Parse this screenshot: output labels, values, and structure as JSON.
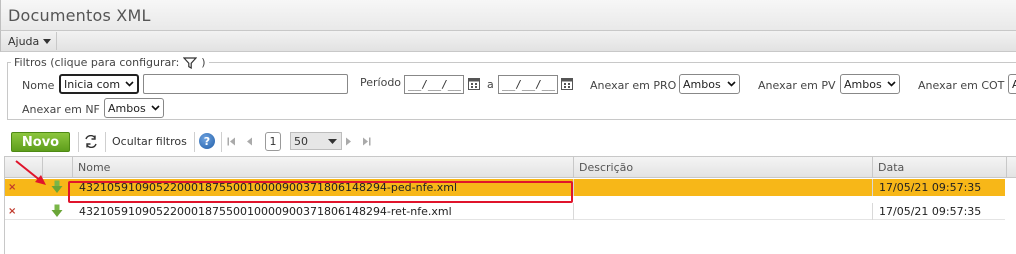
{
  "window": {
    "title": "Documentos XML"
  },
  "menu": {
    "help_label": "Ajuda"
  },
  "filters": {
    "legend": "Filtros (clique para configurar:",
    "nome_label": "Nome",
    "nome_mode": "Inicia com",
    "nome_value": "",
    "periodo_label": "Período",
    "date_from": "__/__/__",
    "date_sep": "a",
    "date_to": "__/__/__",
    "pro_label": "Anexar em PRO",
    "pro_value": "Ambos",
    "pv_label": "Anexar em PV",
    "pv_value": "Ambos",
    "cot_label": "Anexar em COT",
    "cot_value": "A",
    "nf_label": "Anexar em NF",
    "nf_value": "Ambos"
  },
  "toolbar": {
    "new_label": "Novo",
    "hide_filters_label": "Ocultar filtros",
    "help_label": "?",
    "page": "1",
    "page_size": "50"
  },
  "grid": {
    "columns": [
      "Nome",
      "Descrição",
      "Data"
    ],
    "rows": [
      {
        "nome": "43210591090522000187550010000900371806148294-ped-nfe.xml",
        "descricao": "",
        "data": "17/05/21 09:57:35",
        "selected": true
      },
      {
        "nome": "43210591090522000187550010000900371806148294-ret-nfe.xml",
        "descricao": "",
        "data": "17/05/21 09:57:35",
        "selected": false
      }
    ]
  },
  "colors": {
    "selected_row": "#f7b718",
    "highlight": "#e0142b",
    "new_button": "#6aa825"
  }
}
